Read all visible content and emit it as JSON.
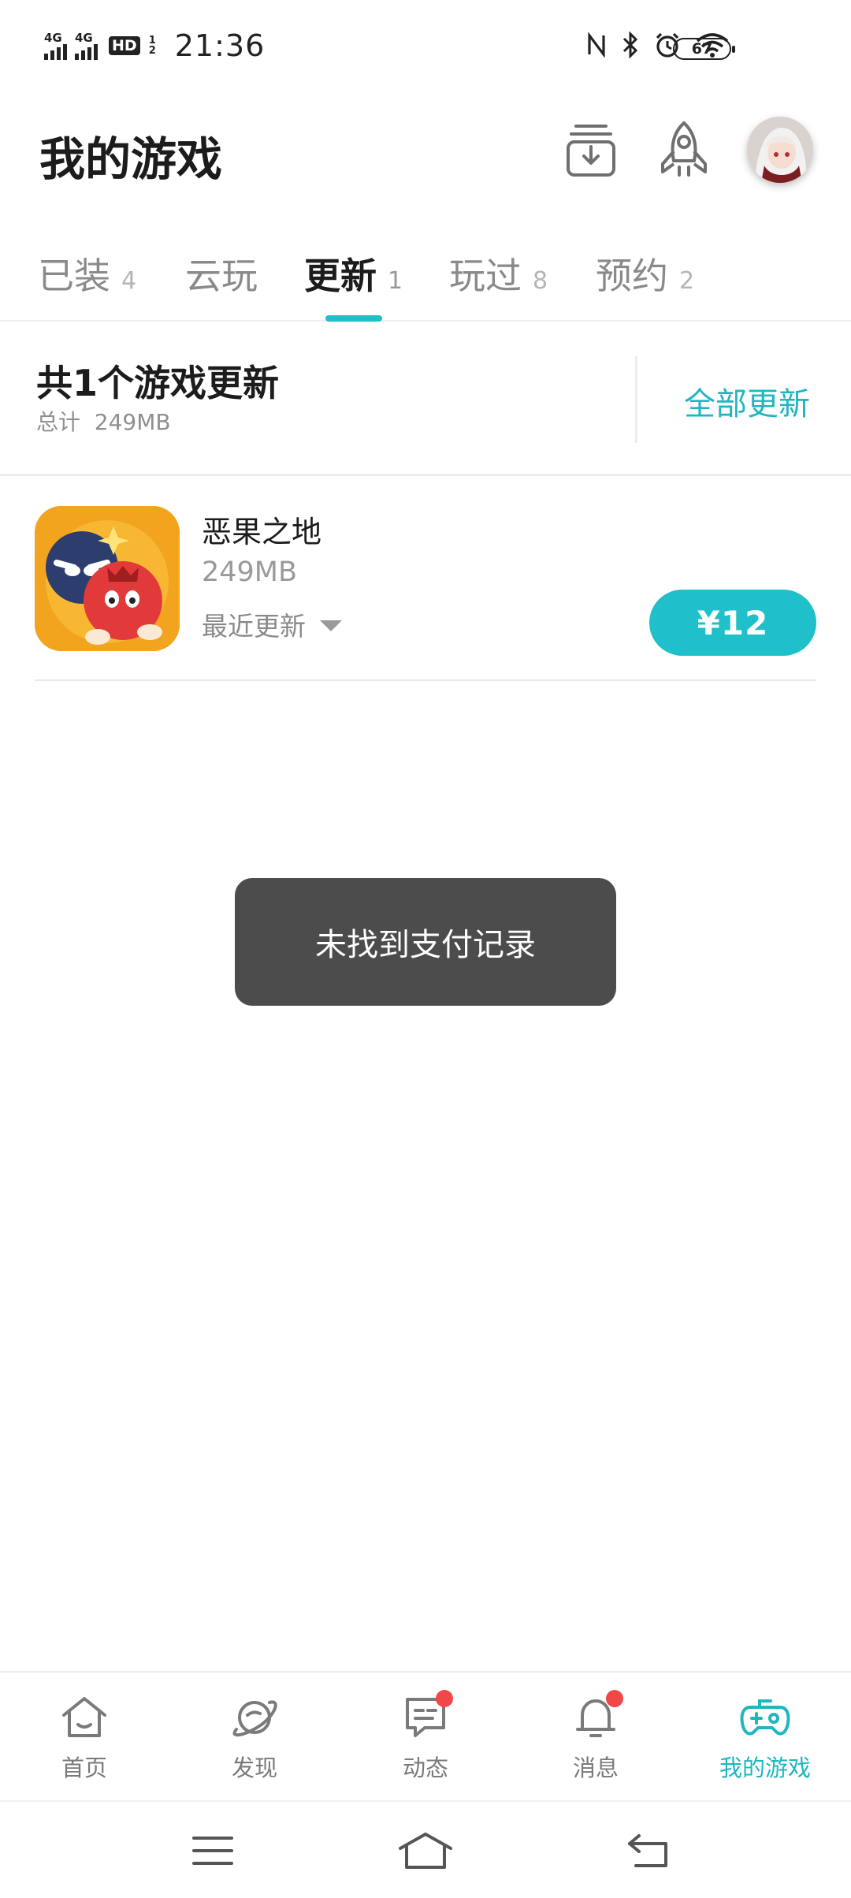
{
  "status_bar": {
    "network_1": "4G",
    "network_2": "4G",
    "hd_badge": "HD",
    "hd_sub_1": "1",
    "hd_sub_2": "2",
    "time": "21:36",
    "battery": "67",
    "icons": [
      "nfc-icon",
      "bluetooth-icon",
      "alarm-icon",
      "wifi-icon",
      "battery-icon"
    ]
  },
  "header": {
    "title": "我的游戏",
    "icons": [
      "download-manager-icon",
      "rocket-icon",
      "avatar"
    ]
  },
  "tabs": [
    {
      "label": "已装",
      "count": "4"
    },
    {
      "label": "云玩",
      "count": ""
    },
    {
      "label": "更新",
      "count": "1",
      "active": true
    },
    {
      "label": "玩过",
      "count": "8"
    },
    {
      "label": "预约",
      "count": "2"
    }
  ],
  "summary": {
    "title": "共1个游戏更新",
    "subtitle": "总计  249MB",
    "action": "全部更新"
  },
  "games": [
    {
      "name": "恶果之地",
      "size": "249MB",
      "note": "最近更新",
      "price": "¥12"
    }
  ],
  "toast": {
    "message": "未找到支付记录"
  },
  "bottom_nav": [
    {
      "label": "首页",
      "icon": "home-icon"
    },
    {
      "label": "发现",
      "icon": "planet-icon"
    },
    {
      "label": "动态",
      "icon": "chat-icon",
      "badge": true
    },
    {
      "label": "消息",
      "icon": "bell-icon",
      "badge": true
    },
    {
      "label": "我的游戏",
      "icon": "gamepad-icon",
      "active": true
    }
  ],
  "colors": {
    "accent": "#1fc0c9",
    "accent_text": "#1fb6c0",
    "badge": "#f04848",
    "toast_bg": "#4c4c4c"
  }
}
